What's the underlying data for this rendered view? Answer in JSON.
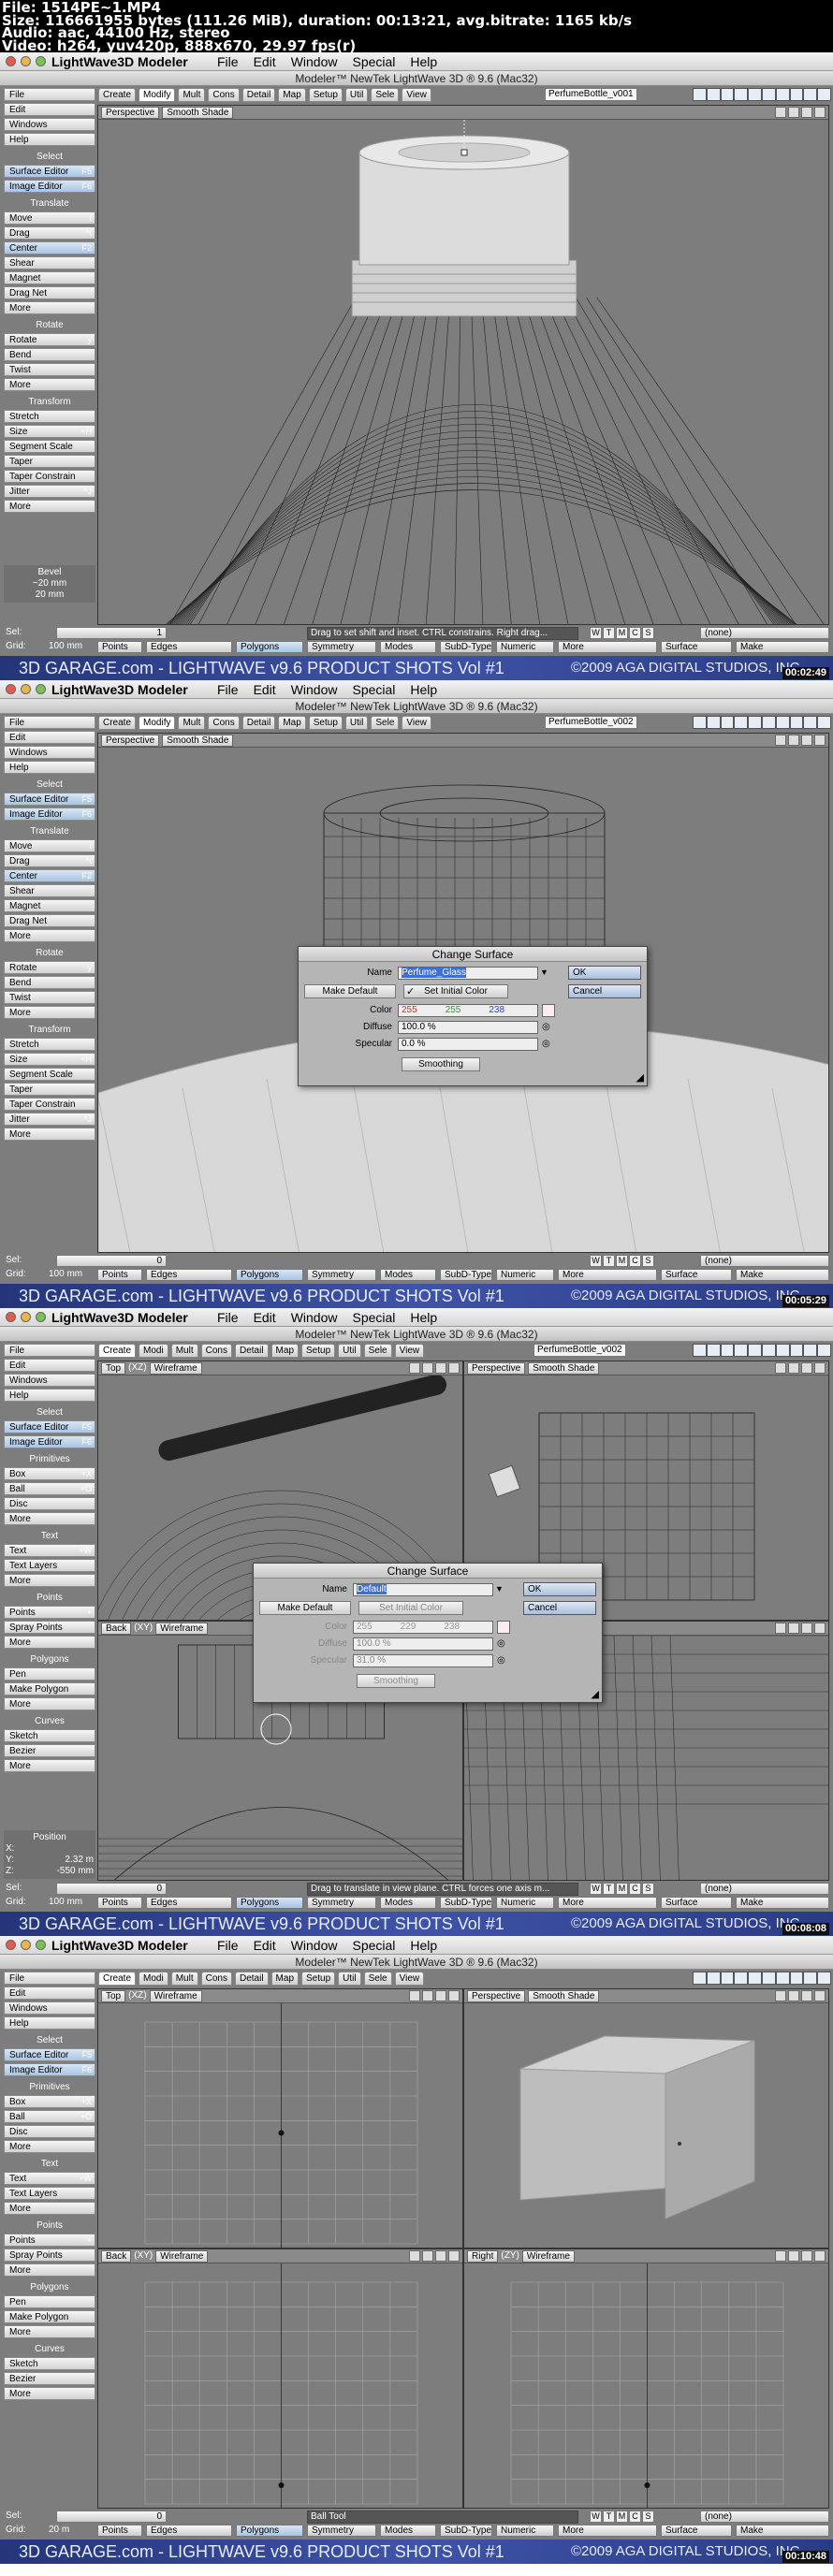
{
  "file_info": {
    "line1": "File: 1514PE~1.MP4",
    "line2": "Size: 116661955 bytes (111.26 MiB), duration: 00:13:21, avg.bitrate: 1165 kb/s",
    "line3": "Audio: aac, 44100 Hz, stereo",
    "line4": "Video: h264, yuv420p, 888x670, 29.97 fps(r)"
  },
  "app": {
    "name": "LightWave3D Modeler",
    "menus": [
      "File",
      "Edit",
      "Window",
      "Special",
      "Help"
    ],
    "window_title": "Modeler™ NewTek LightWave 3D ® 9.6  (Mac32)"
  },
  "banner": {
    "text": "3D GARAGE.com - LIGHTWAVE v9.6 PRODUCT SHOTS  Vol #1",
    "copyright": "©2009 AGA DIGITAL STUDIOS, INC."
  },
  "colors": {
    "banner": "#3f53a8",
    "viewport": "#7d7d7d",
    "wire": "#222222"
  },
  "frames": [
    {
      "timecode": "00:02:49",
      "tabs": [
        {
          "label": "Create",
          "active": false
        },
        {
          "label": "Modify",
          "active": true
        },
        {
          "label": "Mult",
          "active": false
        },
        {
          "label": "Cons",
          "active": false
        },
        {
          "label": "Detail",
          "active": false
        },
        {
          "label": "Map",
          "active": false
        },
        {
          "label": "Setup",
          "active": false
        },
        {
          "label": "Util",
          "active": false
        },
        {
          "label": "Sele",
          "active": false
        },
        {
          "label": "View",
          "active": false
        }
      ],
      "object": "PerfumeBottle_v001",
      "view_label": "Perspective",
      "shade_label": "Smooth Shade",
      "sidebar": [
        {
          "label": "File"
        },
        {
          "label": "Edit"
        },
        {
          "label": "Windows"
        },
        {
          "label": "Help"
        },
        {
          "header": "Select"
        },
        {
          "label": "Surface Editor",
          "key": "F5"
        },
        {
          "label": "Image Editor",
          "key": "F6"
        },
        {
          "header": "Translate"
        },
        {
          "label": "Move",
          "key": "t"
        },
        {
          "label": "Drag",
          "key": "^t"
        },
        {
          "label": "Center",
          "key": "F2"
        },
        {
          "label": "Shear"
        },
        {
          "label": "Magnet"
        },
        {
          "label": "Drag Net"
        },
        {
          "label": "More"
        },
        {
          "header": "Rotate"
        },
        {
          "label": "Rotate",
          "key": "y"
        },
        {
          "label": "Bend"
        },
        {
          "label": "Twist"
        },
        {
          "label": "More"
        },
        {
          "header": "Transform"
        },
        {
          "label": "Stretch"
        },
        {
          "label": "Size",
          "key": "+H"
        },
        {
          "label": "Segment Scale"
        },
        {
          "label": "Taper"
        },
        {
          "label": "Taper Constrain"
        },
        {
          "label": "Jitter",
          "key": "^J"
        },
        {
          "label": "More"
        }
      ],
      "info_lines": [
        "Bevel",
        "~20 mm",
        "20 mm"
      ],
      "sel_label": "Sel:",
      "sel_value": "1",
      "grid_label": "Grid:",
      "grid_value": "100 mm",
      "hint": "Drag to set shift and inset. CTRL constrains. Right drag...",
      "bottom": [
        "Points",
        "Edges",
        "Polygons",
        "Symmetry",
        "Modes",
        "SubD-Type",
        "Numeric",
        "More",
        "Surface",
        "Make"
      ],
      "selected_mode": "Polygons",
      "none_label": "(none)"
    },
    {
      "timecode": "00:05:29",
      "tabs": [
        {
          "label": "Create",
          "active": false
        },
        {
          "label": "Modify",
          "active": true
        },
        {
          "label": "Mult",
          "active": false
        },
        {
          "label": "Cons",
          "active": false
        },
        {
          "label": "Detail",
          "active": false
        },
        {
          "label": "Map",
          "active": false
        },
        {
          "label": "Setup",
          "active": false
        },
        {
          "label": "Util",
          "active": false
        },
        {
          "label": "Sele",
          "active": false
        },
        {
          "label": "View",
          "active": false
        }
      ],
      "object": "PerfumeBottle_v002",
      "view_label": "Perspective",
      "shade_label": "Smooth Shade",
      "sidebar": [
        {
          "label": "File"
        },
        {
          "label": "Edit"
        },
        {
          "label": "Windows"
        },
        {
          "label": "Help"
        },
        {
          "header": "Select"
        },
        {
          "label": "Surface Editor",
          "key": "F5"
        },
        {
          "label": "Image Editor",
          "key": "F6"
        },
        {
          "header": "Translate"
        },
        {
          "label": "Move",
          "key": "t"
        },
        {
          "label": "Drag",
          "key": "^t"
        },
        {
          "label": "Center",
          "key": "F2"
        },
        {
          "label": "Shear"
        },
        {
          "label": "Magnet"
        },
        {
          "label": "Drag Net"
        },
        {
          "label": "More"
        },
        {
          "header": "Rotate"
        },
        {
          "label": "Rotate",
          "key": "y"
        },
        {
          "label": "Bend"
        },
        {
          "label": "Twist"
        },
        {
          "label": "More"
        },
        {
          "header": "Transform"
        },
        {
          "label": "Stretch"
        },
        {
          "label": "Size",
          "key": "+H"
        },
        {
          "label": "Segment Scale"
        },
        {
          "label": "Taper"
        },
        {
          "label": "Taper Constrain"
        },
        {
          "label": "Jitter",
          "key": "^J"
        },
        {
          "label": "More"
        }
      ],
      "sel_label": "Sel:",
      "sel_value": "0",
      "grid_label": "Grid:",
      "grid_value": "100 mm",
      "bottom": [
        "Points",
        "Edges",
        "Polygons",
        "Symmetry",
        "Modes",
        "SubD-Type",
        "Numeric",
        "More",
        "Surface",
        "Make"
      ],
      "selected_mode": "Polygons",
      "none_label": "(none)",
      "dialog": {
        "title": "Change Surface",
        "name_label": "Name",
        "name_value": "Perfume_Glass",
        "make_default": "Make Default",
        "set_initial": "Set Initial Color",
        "color_label": "Color",
        "color_r": "255",
        "color_g": "255",
        "color_b": "238",
        "diffuse_label": "Diffuse",
        "diffuse_value": "100.0 %",
        "specular_label": "Specular",
        "specular_value": "0.0 %",
        "smoothing": "Smoothing",
        "ok": "OK",
        "cancel": "Cancel"
      }
    },
    {
      "timecode": "00:08:08",
      "tabs": [
        {
          "label": "Create",
          "active": true
        },
        {
          "label": "Modi",
          "active": false
        },
        {
          "label": "Mult",
          "active": false
        },
        {
          "label": "Cons",
          "active": false
        },
        {
          "label": "Detail",
          "active": false
        },
        {
          "label": "Map",
          "active": false
        },
        {
          "label": "Setup",
          "active": false
        },
        {
          "label": "Util",
          "active": false
        },
        {
          "label": "Sele",
          "active": false
        },
        {
          "label": "View",
          "active": false
        }
      ],
      "object": "PerfumeBottle_v002",
      "views": [
        {
          "label": "Top",
          "axes": "(XZ)",
          "shade": "Wireframe"
        },
        {
          "label": "Perspective",
          "axes": "",
          "shade": "Smooth Shade"
        },
        {
          "label": "Back",
          "axes": "(XY)",
          "shade": "Wireframe"
        },
        {
          "label": "",
          "axes": "",
          "shade": ""
        }
      ],
      "sidebar": [
        {
          "label": "File"
        },
        {
          "label": "Edit"
        },
        {
          "label": "Windows"
        },
        {
          "label": "Help"
        },
        {
          "header": "Select"
        },
        {
          "label": "Surface Editor",
          "key": "F5"
        },
        {
          "label": "Image Editor",
          "key": "F6"
        },
        {
          "header": "Primitives"
        },
        {
          "label": "Box",
          "key": "+X"
        },
        {
          "label": "Ball",
          "key": "+O"
        },
        {
          "label": "Disc"
        },
        {
          "label": "More"
        },
        {
          "header": "Text"
        },
        {
          "label": "Text",
          "key": "+W"
        },
        {
          "label": "Text Layers"
        },
        {
          "label": "More"
        },
        {
          "header": "Points"
        },
        {
          "label": "Points",
          "key": "+"
        },
        {
          "label": "Spray Points"
        },
        {
          "label": "More"
        },
        {
          "header": "Polygons"
        },
        {
          "label": "Pen"
        },
        {
          "label": "Make Polygon"
        },
        {
          "label": "More"
        },
        {
          "header": "Curves"
        },
        {
          "label": "Sketch"
        },
        {
          "label": "Bezier"
        },
        {
          "label": "More"
        }
      ],
      "position": {
        "title": "Position",
        "x_label": "X:",
        "x_value": "",
        "y_label": "Y:",
        "y_value": "2.32 m",
        "z_label": "Z:",
        "z_value": "-550 mm"
      },
      "sel_label": "Sel:",
      "sel_value": "0",
      "grid_label": "Grid:",
      "grid_value": "100 mm",
      "hint": "Drag to translate in view plane. CTRL forces one axis m...",
      "bottom": [
        "Points",
        "Edges",
        "Polygons",
        "Symmetry",
        "Modes",
        "SubD-Type",
        "Numeric",
        "More",
        "Surface",
        "Make"
      ],
      "selected_mode": "Polygons",
      "none_label": "(none)",
      "dialog": {
        "title": "Change Surface",
        "name_label": "Name",
        "name_value": "Default",
        "make_default": "Make Default",
        "set_initial": "Set Initial Color",
        "color_label": "Color",
        "color_r": "255",
        "color_g": "229",
        "color_b": "238",
        "diffuse_label": "Diffuse",
        "diffuse_value": "100.0 %",
        "specular_label": "Specular",
        "specular_value": "31.0 %",
        "smoothing": "Smoothing",
        "ok": "OK",
        "cancel": "Cancel"
      }
    },
    {
      "timecode": "00:10:48",
      "tabs": [
        {
          "label": "Create",
          "active": true
        },
        {
          "label": "Modi",
          "active": false
        },
        {
          "label": "Mult",
          "active": false
        },
        {
          "label": "Cons",
          "active": false
        },
        {
          "label": "Detail",
          "active": false
        },
        {
          "label": "Map",
          "active": false
        },
        {
          "label": "Setup",
          "active": false
        },
        {
          "label": "Util",
          "active": false
        },
        {
          "label": "Sele",
          "active": false
        },
        {
          "label": "View",
          "active": false
        }
      ],
      "object": "",
      "views": [
        {
          "label": "Top",
          "axes": "(XZ)",
          "shade": "Wireframe"
        },
        {
          "label": "Perspective",
          "axes": "",
          "shade": "Smooth Shade"
        },
        {
          "label": "Back",
          "axes": "(XY)",
          "shade": "Wireframe"
        },
        {
          "label": "Right",
          "axes": "(ZY)",
          "shade": "Wireframe"
        }
      ],
      "sidebar": [
        {
          "label": "File"
        },
        {
          "label": "Edit"
        },
        {
          "label": "Windows"
        },
        {
          "label": "Help"
        },
        {
          "header": "Select"
        },
        {
          "label": "Surface Editor",
          "key": "F5"
        },
        {
          "label": "Image Editor",
          "key": "F6"
        },
        {
          "header": "Primitives"
        },
        {
          "label": "Box",
          "key": "+X"
        },
        {
          "label": "Ball",
          "key": "+O"
        },
        {
          "label": "Disc"
        },
        {
          "label": "More"
        },
        {
          "header": "Text"
        },
        {
          "label": "Text",
          "key": "+W"
        },
        {
          "label": "Text Layers"
        },
        {
          "label": "More"
        },
        {
          "header": "Points"
        },
        {
          "label": "Points",
          "key": "+"
        },
        {
          "label": "Spray Points"
        },
        {
          "label": "More"
        },
        {
          "header": "Polygons"
        },
        {
          "label": "Pen"
        },
        {
          "label": "Make Polygon"
        },
        {
          "label": "More"
        },
        {
          "header": "Curves"
        },
        {
          "label": "Sketch"
        },
        {
          "label": "Bezier"
        },
        {
          "label": "More"
        }
      ],
      "sel_label": "Sel:",
      "sel_value": "0",
      "grid_label": "Grid:",
      "grid_value": "20 m",
      "hint": "Ball Tool",
      "bottom": [
        "Points",
        "Edges",
        "Polygons",
        "Symmetry",
        "Modes",
        "SubD-Type",
        "Numeric",
        "More",
        "Surface",
        "Make"
      ],
      "selected_mode": "Polygons",
      "none_label": "(none)"
    }
  ]
}
